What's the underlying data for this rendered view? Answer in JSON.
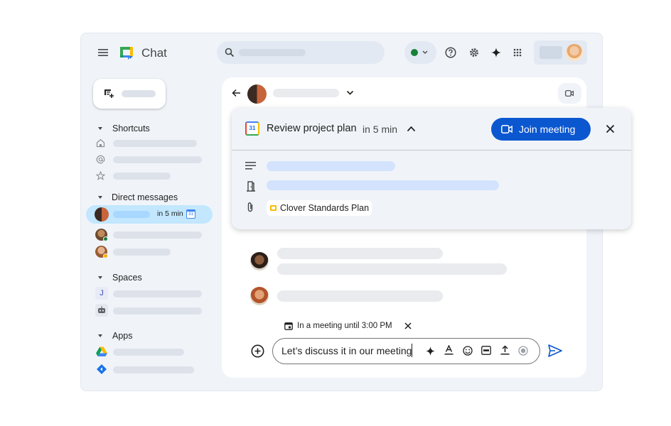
{
  "app": {
    "title": "Chat"
  },
  "sidebar": {
    "sections": {
      "shortcuts": "Shortcuts",
      "direct_messages": "Direct messages",
      "spaces": "Spaces",
      "apps": "Apps"
    },
    "active_dm_time": "in 5 min",
    "space_initial": "J"
  },
  "meeting": {
    "title": "Review project plan",
    "time": "in 5 min",
    "join_label": "Join meeting",
    "calendar_day": "31",
    "attachment": "Clover Standards Plan"
  },
  "compose": {
    "status_note": "In a meeting until 3:00 PM",
    "value": "Let’s discuss it in our meeting"
  },
  "colors": {
    "accent": "#0b57d0",
    "active_item": "#c2e7ff",
    "online": "#188038"
  }
}
